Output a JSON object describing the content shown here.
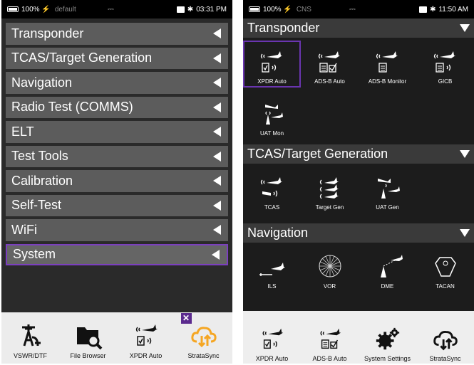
{
  "left": {
    "status": {
      "battery": "100%",
      "profile": "default",
      "time": "03:31 PM"
    },
    "menu": [
      {
        "label": "Transponder"
      },
      {
        "label": "TCAS/Target Generation"
      },
      {
        "label": "Navigation"
      },
      {
        "label": "Radio Test (COMMS)"
      },
      {
        "label": "ELT"
      },
      {
        "label": "Test Tools"
      },
      {
        "label": "Calibration"
      },
      {
        "label": "Self-Test"
      },
      {
        "label": "WiFi"
      },
      {
        "label": "System",
        "selected": true
      }
    ],
    "dock": [
      {
        "label": "VSWR/DTF",
        "icon": "antenna-icon"
      },
      {
        "label": "File Browser",
        "icon": "folder-search-icon"
      },
      {
        "label": "XPDR Auto",
        "icon": "transponder-icon"
      },
      {
        "label": "StrataSync",
        "icon": "cloud-sync-icon"
      }
    ]
  },
  "right": {
    "status": {
      "battery": "100%",
      "profile": "CNS",
      "time": "11:50 AM"
    },
    "sections": [
      {
        "title": "Transponder",
        "tiles": [
          {
            "label": "XPDR Auto",
            "icon": "transponder-icon",
            "selected": true
          },
          {
            "label": "ADS-B Auto",
            "icon": "adsb-auto-icon"
          },
          {
            "label": "ADS-B Monitor",
            "icon": "adsb-monitor-icon"
          },
          {
            "label": "GICB",
            "icon": "gicb-icon"
          },
          {
            "label": "UAT Mon",
            "icon": "uat-monitor-icon"
          }
        ]
      },
      {
        "title": "TCAS/Target Generation",
        "tiles": [
          {
            "label": "TCAS",
            "icon": "tcas-icon"
          },
          {
            "label": "Target Gen",
            "icon": "target-gen-icon"
          },
          {
            "label": "UAT Gen",
            "icon": "uat-gen-icon"
          }
        ]
      },
      {
        "title": "Navigation",
        "tiles": [
          {
            "label": "ILS",
            "icon": "ils-icon"
          },
          {
            "label": "VOR",
            "icon": "vor-icon"
          },
          {
            "label": "DME",
            "icon": "dme-icon"
          },
          {
            "label": "TACAN",
            "icon": "tacan-icon"
          }
        ]
      }
    ],
    "dock": [
      {
        "label": "XPDR Auto",
        "icon": "transponder-icon"
      },
      {
        "label": "ADS-B Auto",
        "icon": "adsb-auto-icon"
      },
      {
        "label": "System Settings",
        "icon": "gears-icon"
      },
      {
        "label": "StrataSync",
        "icon": "cloud-sync-icon"
      }
    ]
  }
}
